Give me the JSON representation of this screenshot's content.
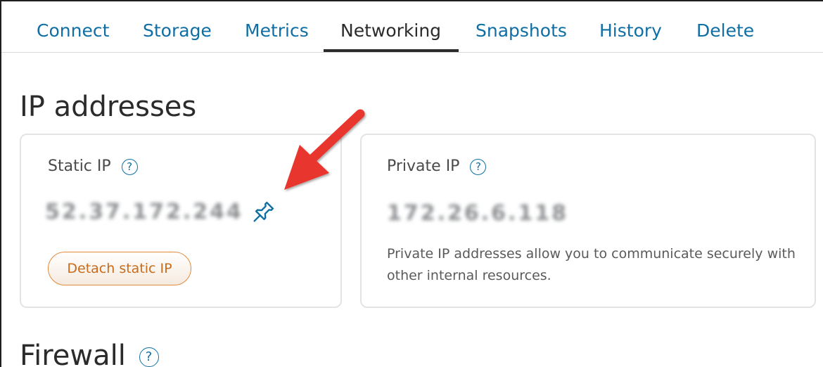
{
  "tabs": [
    {
      "label": "Connect",
      "active": false
    },
    {
      "label": "Storage",
      "active": false
    },
    {
      "label": "Metrics",
      "active": false
    },
    {
      "label": "Networking",
      "active": true
    },
    {
      "label": "Snapshots",
      "active": false
    },
    {
      "label": "History",
      "active": false
    },
    {
      "label": "Delete",
      "active": false
    }
  ],
  "ip_section": {
    "title": "IP addresses",
    "static_ip": {
      "label": "Static IP",
      "help_icon": "question-circle-icon",
      "value": "52.37.172.244",
      "value_blurred": true,
      "pin_icon": "pin-icon",
      "detach_button": "Detach static IP"
    },
    "private_ip": {
      "label": "Private IP",
      "help_icon": "question-circle-icon",
      "value": "172.26.6.118",
      "value_blurred": true,
      "description": "Private IP addresses allow you to communicate securely with other internal resources."
    }
  },
  "firewall_section": {
    "title": "Firewall",
    "help_icon": "question-circle-icon"
  },
  "annotation": {
    "arrow_color": "#e8362f",
    "arrow_points_to": "pin-icon"
  },
  "colors": {
    "link": "#0f6fa5",
    "active_tab": "#2b2b2b",
    "button_accent": "#e08a3c"
  }
}
